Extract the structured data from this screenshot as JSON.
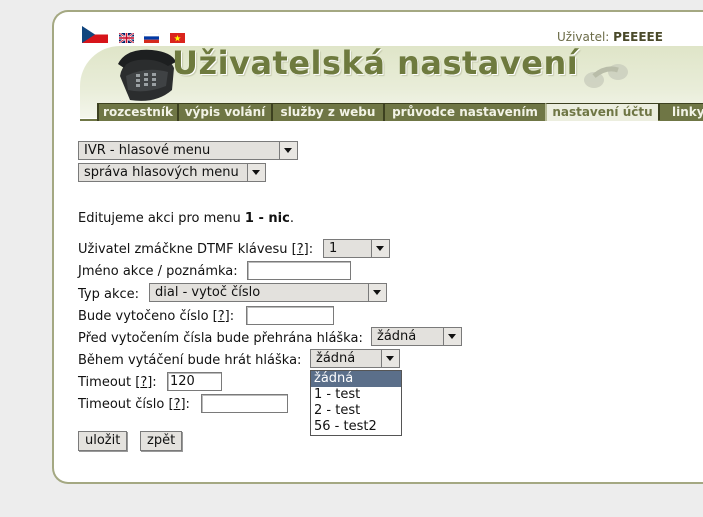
{
  "header": {
    "title": "Uživatelská nastavení",
    "user_label": "Uživatel:",
    "user_name": "PEEEEE",
    "flags": [
      "czech-flag",
      "uk-flag",
      "russian-flag",
      "vietnamese-flag"
    ]
  },
  "tabs": [
    {
      "label": "rozcestník",
      "active": false
    },
    {
      "label": "výpis volání",
      "active": false
    },
    {
      "label": "služby z webu",
      "active": false
    },
    {
      "label": "průvodce nastavením",
      "active": false
    },
    {
      "label": "nastavení účtu",
      "active": true
    },
    {
      "label": "linky",
      "active": false
    }
  ],
  "menus": {
    "main_select": "IVR - hlasové menu",
    "sub_select": "správa hlasových menu"
  },
  "form": {
    "editing_prefix": "Editujeme akci pro menu",
    "editing_menu": "1 - nic",
    "editing_suffix": ".",
    "dtmf_label": "Uživatel zmáčkne DTMF klávesu",
    "help": "?",
    "dtmf_value": "1",
    "name_label": "Jméno akce / poznámka:",
    "name_value": "",
    "type_label": "Typ akce:",
    "type_value": "dial - vytoč číslo",
    "dial_label": "Bude vytočeno číslo",
    "dial_value": "",
    "before_label": "Před vytočením čísla bude přehrána hláška:",
    "before_value": "žádná",
    "during_label": "Během vytáčení bude hrát hláška:",
    "during_value": "žádná",
    "timeout_label": "Timeout",
    "timeout_value": "120",
    "timeout_number_label": "Timeout číslo",
    "timeout_number_value": "",
    "dropdown_options": [
      "žádná",
      "1 - test",
      "2 - test",
      "56 - test2"
    ]
  },
  "buttons": {
    "save": "uložit",
    "back": "zpět"
  },
  "colors": {
    "tab_bg": "#6f7645",
    "title": "#6e7a3e",
    "header_band": "#dfe5c8",
    "selected_option": "#5b6f8a"
  }
}
